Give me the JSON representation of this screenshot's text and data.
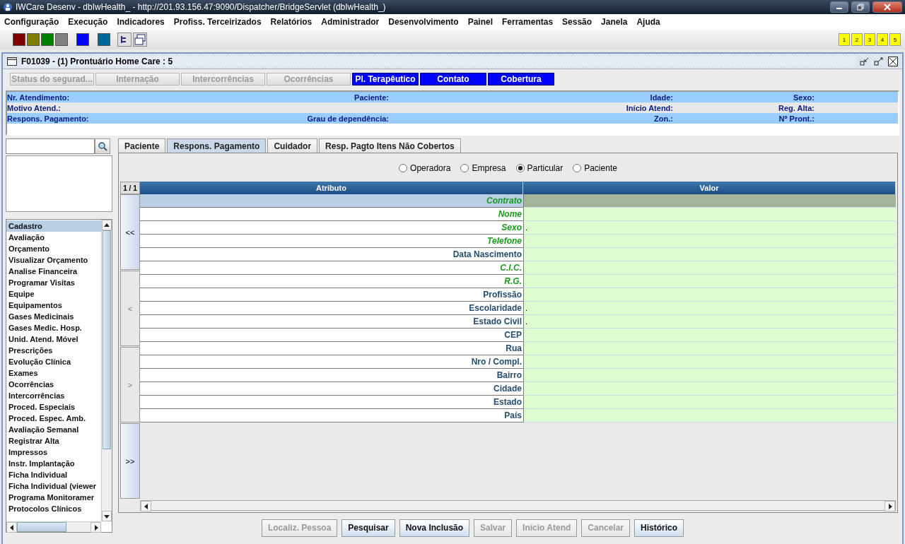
{
  "window": {
    "title": "IWCare Desenv - dbIwHealth_ - http://201.93.156.47:9090/Dispatcher/BridgeServlet (dbIwHealth_)"
  },
  "menu": [
    "Configuração",
    "Execução",
    "Indicadores",
    "Profiss. Terceirizados",
    "Relatórios",
    "Administrador",
    "Desenvolvimento",
    "Painel",
    "Ferramentas",
    "Sessão",
    "Janela",
    "Ajuda"
  ],
  "toolbar": {
    "swatches": [
      {
        "color": "#800000"
      },
      {
        "color": "#808000"
      },
      {
        "color": "#008000"
      },
      {
        "color": "#808080"
      },
      {
        "color": "#0000ff"
      },
      {
        "color": "#006699"
      }
    ],
    "desktops": [
      "1",
      "2",
      "3",
      "4",
      "5"
    ]
  },
  "frame": {
    "title": "F01039 - (1) Prontuário Home Care : 5"
  },
  "top_buttons": [
    {
      "label": "Status do segurad...",
      "disabled": true
    },
    {
      "label": "Internação",
      "disabled": true
    },
    {
      "label": "Intercorrências",
      "disabled": true
    },
    {
      "label": "Ocorrências",
      "disabled": true
    },
    {
      "label": "Pl. Terapêutico",
      "disabled": false
    },
    {
      "label": "Contato",
      "disabled": false
    },
    {
      "label": "Cobertura",
      "disabled": false
    }
  ],
  "info_rows": [
    [
      "Nr. Atendimento:",
      "Paciente:",
      "Idade:",
      "Sexo:"
    ],
    [
      "Motivo Atend.:",
      "",
      "Início Atend:",
      "Reg. Alta:"
    ],
    [
      "Respons. Pagamento:",
      "Grau de dependência:",
      "Zon.:",
      "Nº Pront.:"
    ]
  ],
  "sidebar": {
    "items": [
      {
        "label": "Cadastro",
        "selected": true
      },
      {
        "label": "Avaliação",
        "selected": false
      },
      {
        "label": "Orçamento",
        "selected": false
      },
      {
        "label": "Visualizar Orçamento",
        "selected": false
      },
      {
        "label": "Analise Financeira",
        "selected": false
      },
      {
        "label": "Programar Visitas",
        "selected": false
      },
      {
        "label": "Equipe",
        "selected": false
      },
      {
        "label": "Equipamentos",
        "selected": false
      },
      {
        "label": "Gases Medicinais",
        "selected": false
      },
      {
        "label": "Gases Medic. Hosp.",
        "selected": false
      },
      {
        "label": "Unid. Atend. Móvel",
        "selected": false
      },
      {
        "label": "Prescrições",
        "selected": false
      },
      {
        "label": "Evolução Clínica",
        "selected": false
      },
      {
        "label": "Exames",
        "selected": false
      },
      {
        "label": "Ocorrências",
        "selected": false
      },
      {
        "label": "Intercorrências",
        "selected": false
      },
      {
        "label": "Proced. Especiais",
        "selected": false
      },
      {
        "label": "Proced. Espec. Amb.",
        "selected": false
      },
      {
        "label": "Avaliação Semanal",
        "selected": false
      },
      {
        "label": "Registrar Alta",
        "selected": false
      },
      {
        "label": "Impressos",
        "selected": false
      },
      {
        "label": "Instr. Implantação",
        "selected": false
      },
      {
        "label": "Ficha Individual",
        "selected": false
      },
      {
        "label": "Ficha Individual (viewer",
        "selected": false
      },
      {
        "label": "Programa Monitoramer",
        "selected": false
      },
      {
        "label": "Protocolos Clínicos",
        "selected": false
      }
    ]
  },
  "tabs": [
    {
      "label": "Paciente",
      "selected": false
    },
    {
      "label": "Respons. Pagamento",
      "selected": true
    },
    {
      "label": "Cuidador",
      "selected": false
    },
    {
      "label": "Resp. Pagto Itens Não Cobertos",
      "selected": false
    }
  ],
  "radios": [
    {
      "label": "Operadora",
      "selected": false
    },
    {
      "label": "Empresa",
      "selected": false
    },
    {
      "label": "Particular",
      "selected": true
    },
    {
      "label": "Paciente",
      "selected": false
    }
  ],
  "table": {
    "page": "1 / 1",
    "columns": [
      "Atributo",
      "Valor"
    ],
    "nav": [
      "<<",
      "<",
      ">",
      ">>"
    ],
    "rows": [
      {
        "attribute": "Contrato",
        "required": true,
        "selected": true
      },
      {
        "attribute": "Nome",
        "required": true,
        "selected": false
      },
      {
        "attribute": "Sexo",
        "value": ".",
        "required": true,
        "selected": false
      },
      {
        "attribute": "Telefone",
        "required": true,
        "selected": false
      },
      {
        "attribute": "Data Nascimento",
        "required": false,
        "selected": false
      },
      {
        "attribute": "C.I.C.",
        "required": true,
        "selected": false
      },
      {
        "attribute": "R.G.",
        "required": true,
        "selected": false
      },
      {
        "attribute": "Profissão",
        "required": false,
        "selected": false
      },
      {
        "attribute": "Escolaridade",
        "value": ".",
        "required": false,
        "selected": false
      },
      {
        "attribute": "Estado Civil",
        "value": ".",
        "required": false,
        "selected": false
      },
      {
        "attribute": "CEP",
        "required": false,
        "selected": false
      },
      {
        "attribute": "Rua",
        "required": false,
        "selected": false
      },
      {
        "attribute": "Nro / Compl.",
        "required": false,
        "selected": false
      },
      {
        "attribute": "Bairro",
        "required": false,
        "selected": false
      },
      {
        "attribute": "Cidade",
        "required": false,
        "selected": false
      },
      {
        "attribute": "Estado",
        "required": false,
        "selected": false
      },
      {
        "attribute": "País",
        "required": false,
        "selected": false
      }
    ]
  },
  "buttons": [
    {
      "label": "Localiz. Pessoa",
      "disabled": true
    },
    {
      "label": "Pesquisar",
      "disabled": false
    },
    {
      "label": "Nova Inclusão",
      "disabled": false
    },
    {
      "label": "Salvar",
      "disabled": true
    },
    {
      "label": "Início Atend",
      "disabled": true
    },
    {
      "label": "Cancelar",
      "disabled": true
    },
    {
      "label": "Histórico",
      "disabled": false
    }
  ]
}
